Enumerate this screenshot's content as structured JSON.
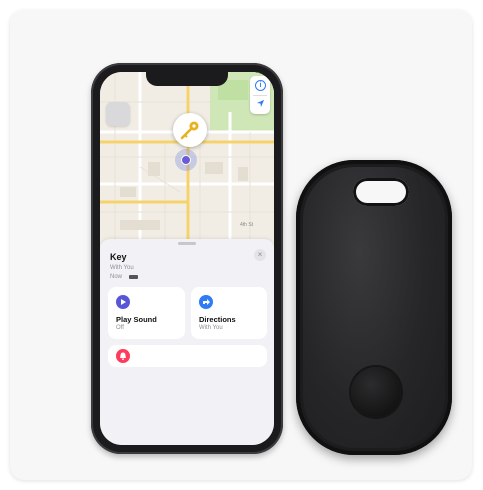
{
  "sheet": {
    "title": "Key",
    "subtitle": "With You",
    "status": "Now"
  },
  "actions": {
    "play_sound": {
      "label": "Play Sound",
      "sub": "Off",
      "color": "#5856d6"
    },
    "directions": {
      "label": "Directions",
      "sub": "With You",
      "color": "#2f7cf6"
    },
    "third": {
      "color": "#ff3b5c"
    }
  },
  "map": {
    "close_symbol": "×",
    "info_symbol": "i",
    "label_1": "4th St"
  },
  "colors": {
    "map_bg": "#f1ede4",
    "road": "#ffffff",
    "highway": "#f6d26b",
    "park": "#cfe7b6",
    "tag_body": "#1c1c1e"
  }
}
